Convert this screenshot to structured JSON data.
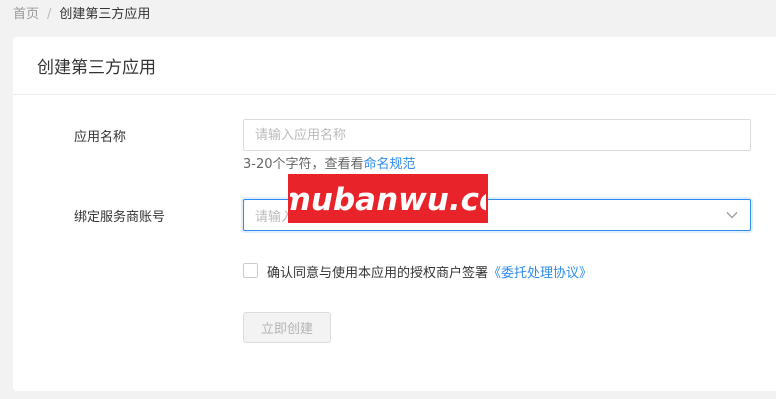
{
  "breadcrumb": {
    "home": "首页",
    "separator": "/",
    "current": "创建第三方应用"
  },
  "card": {
    "title": "创建第三方应用"
  },
  "form": {
    "app_name_label": "应用名称",
    "app_name_placeholder": "请输入应用名称",
    "hint_prefix": "3-20个字符，查看看",
    "hint_link": "命名规范",
    "merchant_label": "绑定服务商账号",
    "merchant_placeholder": "请输入",
    "agree_text": "确认同意与使用本应用的授权商户签署",
    "agree_link": "《委托处理协议》",
    "submit_label": "立即创建"
  },
  "watermark": {
    "text": "mubanwu.cc"
  },
  "colors": {
    "accent": "#2d8cf0",
    "watermark_bg": "#e8232a",
    "page_bg": "#f2f2f2"
  }
}
